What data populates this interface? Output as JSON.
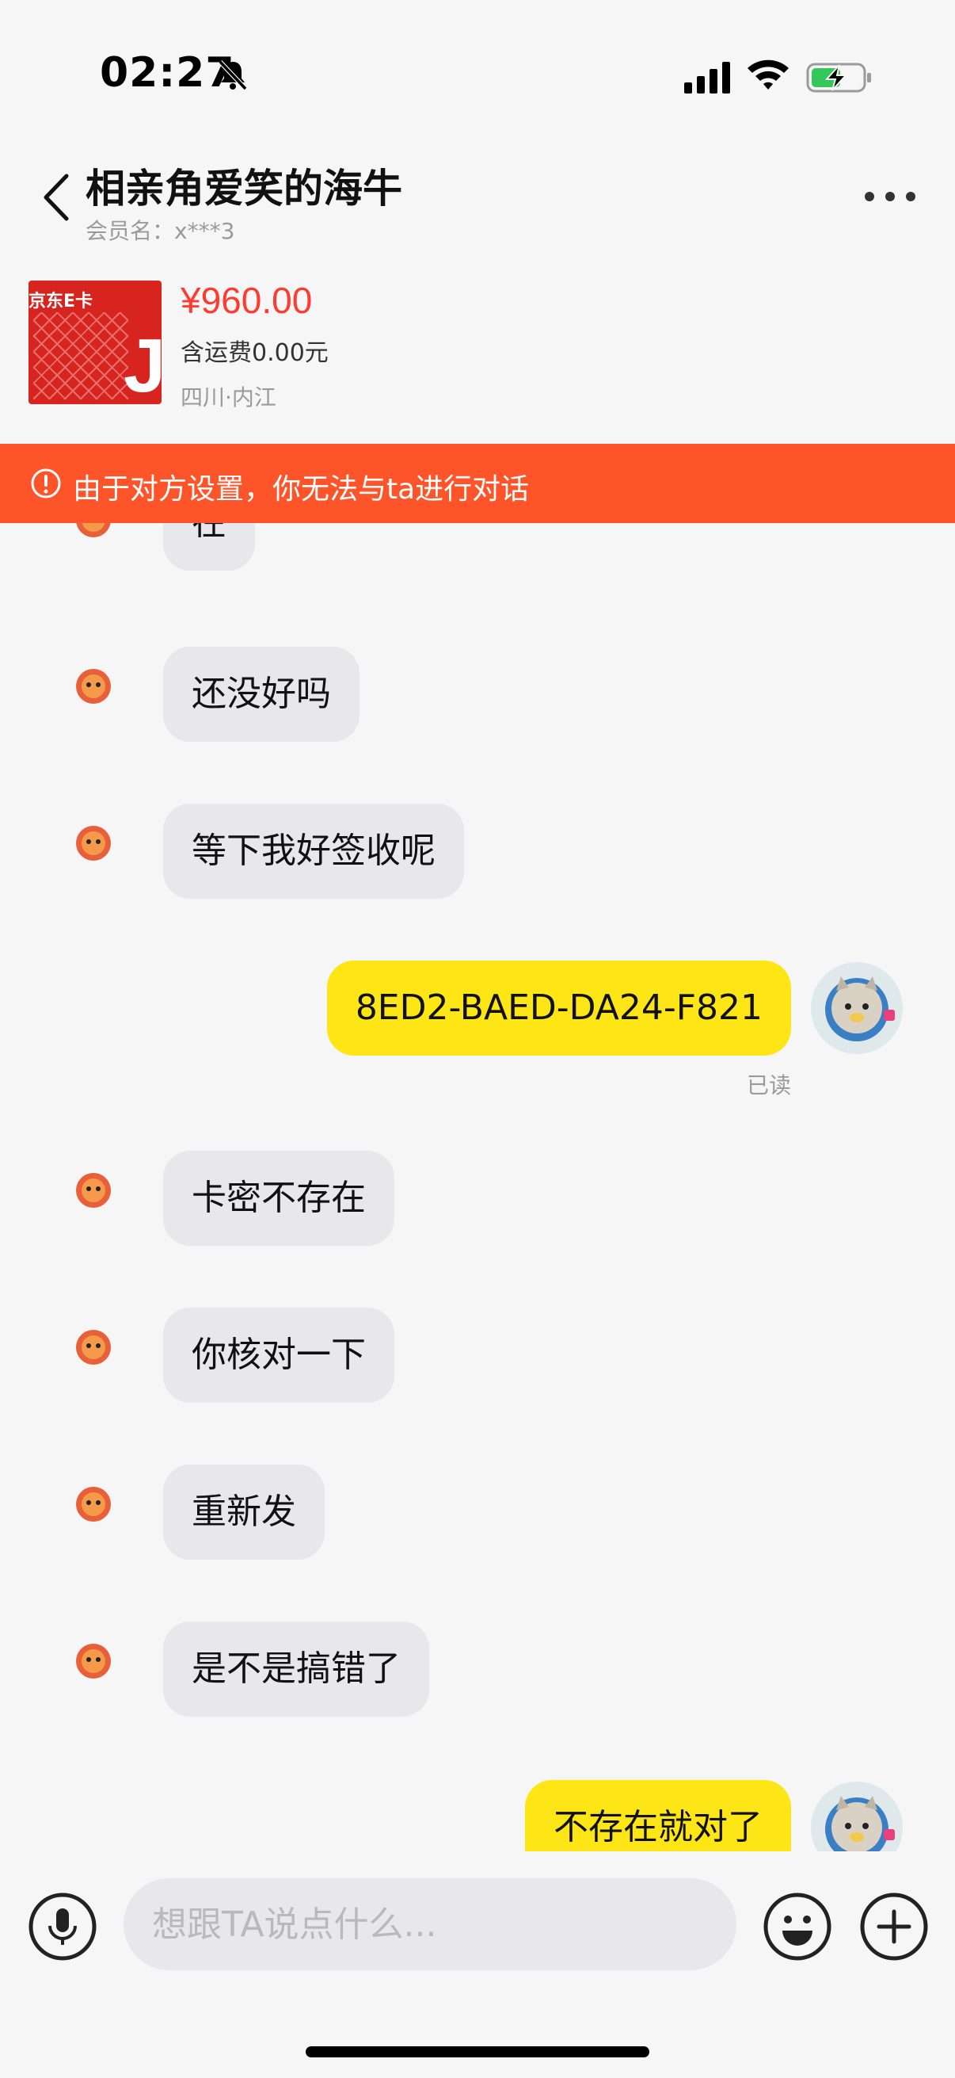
{
  "status_bar": {
    "time": "02:27",
    "icons": [
      "bell-slash-icon",
      "cellular-signal-icon",
      "wifi-icon",
      "battery-charging-icon"
    ]
  },
  "header": {
    "contact_name": "相亲角爱笑的海牛",
    "member_name": "会员名：x***3",
    "icons": [
      "back-icon",
      "more-icon"
    ]
  },
  "product": {
    "image_label": "京东E卡",
    "image_logo": "JD",
    "price": "¥960.00",
    "shipping": "含运费0.00元",
    "location": "四川·内江"
  },
  "banner": {
    "text": "由于对方设置，你无法与ta进行对话",
    "icon": "alert-circle-icon"
  },
  "messages": [
    {
      "side": "left",
      "text": "在"
    },
    {
      "side": "left",
      "text": "还没好吗"
    },
    {
      "side": "left",
      "text": "等下我好签收呢"
    },
    {
      "side": "right",
      "text": "8ED2-BAED-DA24-F821",
      "status": "已读"
    },
    {
      "side": "left",
      "text": "卡密不存在"
    },
    {
      "side": "left",
      "text": "你核对一下"
    },
    {
      "side": "left",
      "text": "重新发"
    },
    {
      "side": "left",
      "text": "是不是搞错了"
    },
    {
      "side": "right",
      "text": "不存在就对了"
    }
  ],
  "input_bar": {
    "placeholder": "想跟TA说点什么...",
    "icons": [
      "microphone-icon",
      "emoji-icon",
      "plus-icon"
    ]
  },
  "colors": {
    "banner": "#fd5429",
    "price": "#ff3b30",
    "outgoing_bubble": "#fde516",
    "incoming_bubble": "#e8e8ec"
  }
}
